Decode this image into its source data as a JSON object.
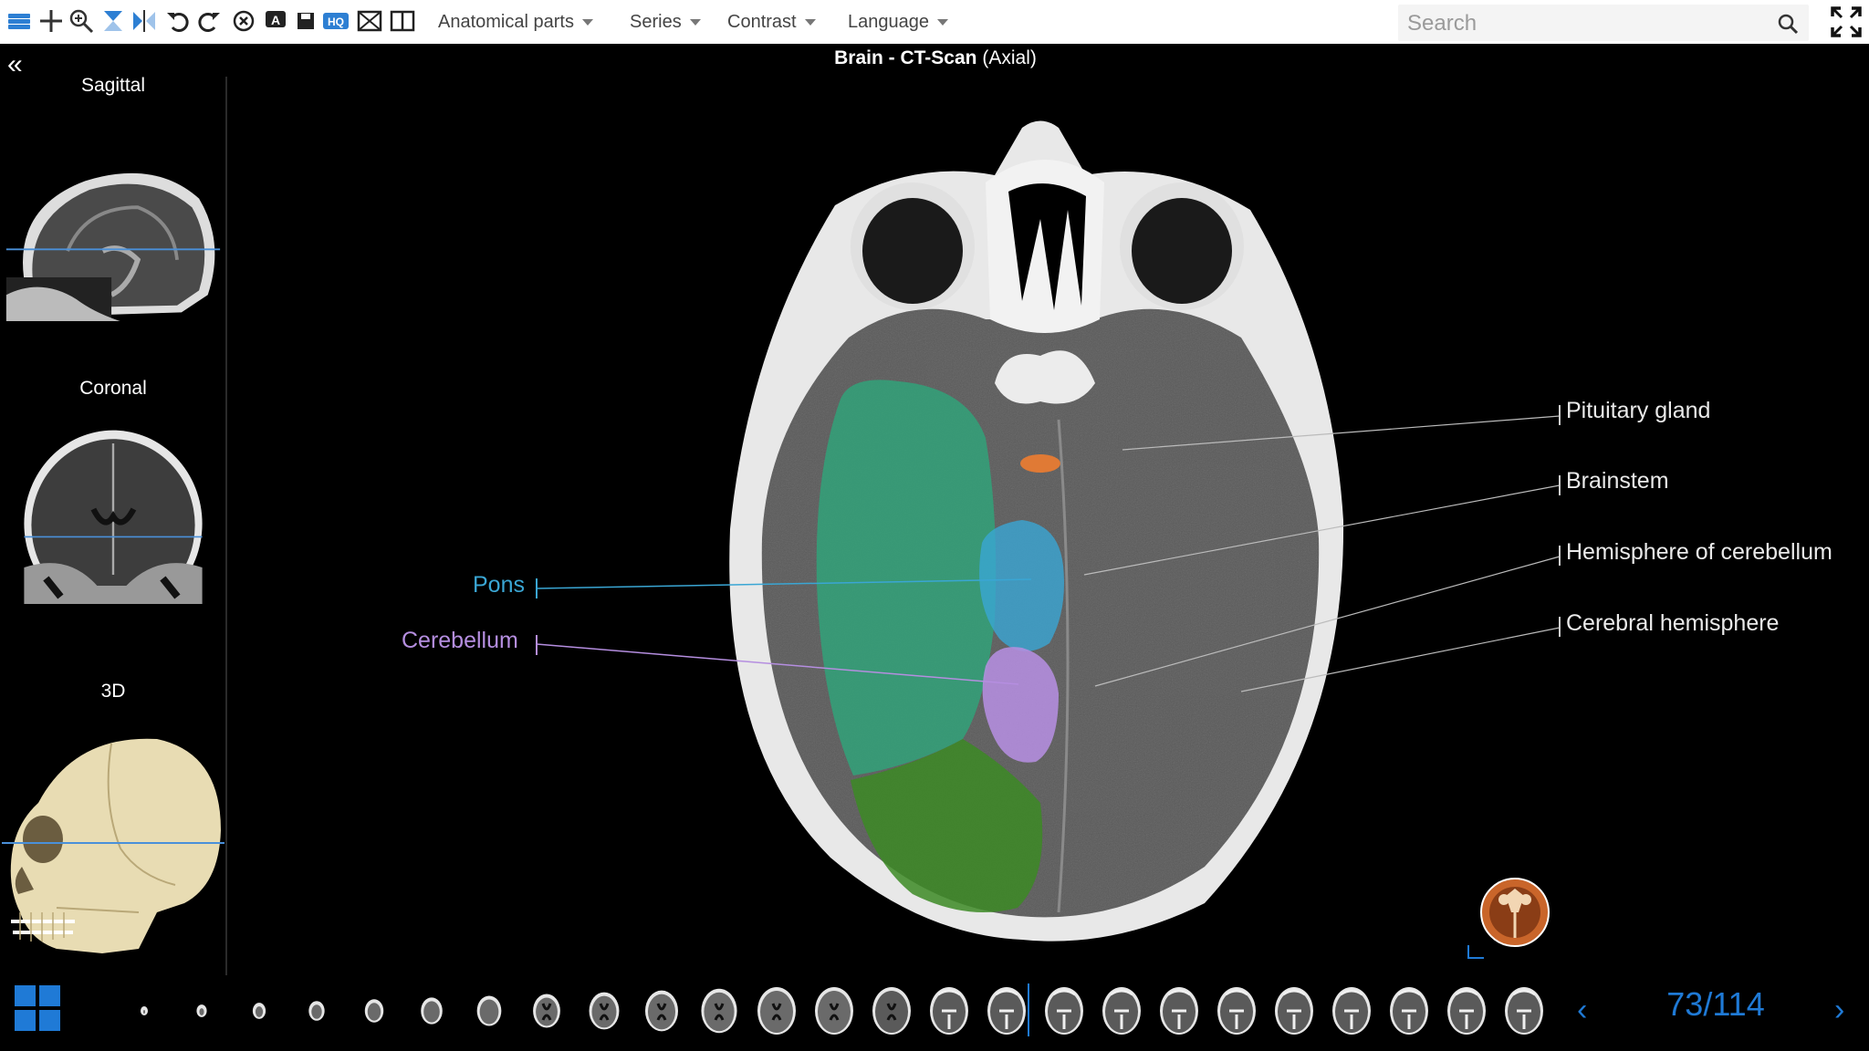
{
  "toolbar": {
    "icons": [
      "layers-icon",
      "crosshair-icon",
      "zoom-in-icon",
      "contrast-icon",
      "flip-icon",
      "rotate-left-icon",
      "rotate-right-icon",
      "reset-icon",
      "annotation-icon",
      "save-icon",
      "hq-icon",
      "image-icon",
      "split-view-icon"
    ],
    "hq_label": "HQ",
    "menus": {
      "anatomical_parts": "Anatomical parts",
      "series": "Series",
      "contrast": "Contrast",
      "language": "Language"
    },
    "search_placeholder": "Search"
  },
  "sidebar": {
    "collapse_glyph": "«",
    "views": {
      "sagittal": "Sagittal",
      "coronal": "Coronal",
      "three_d": "3D"
    }
  },
  "main": {
    "title_bold": "Brain - CT-Scan",
    "title_suffix": "(Axial)"
  },
  "labels": {
    "pons": "Pons",
    "cerebellum": "Cerebellum",
    "pituitary_gland": "Pituitary gland",
    "brainstem": "Brainstem",
    "hemisphere_of_cerebellum": "Hemisphere of cerebellum",
    "cerebral_hemisphere": "Cerebral hemisphere"
  },
  "colors": {
    "pons": "#3aa6d4",
    "cerebellum": "#b58ee0",
    "pituitary": "#e07a35",
    "cerebral_overlay": "#2fa57a",
    "cerebellum_overlay": "#3c8a25",
    "accent": "#1f7ad6"
  },
  "navigation": {
    "prev_glyph": "‹",
    "next_glyph": "›",
    "current_slice": "73",
    "total_slices": "114",
    "counter_text": "73/114"
  }
}
